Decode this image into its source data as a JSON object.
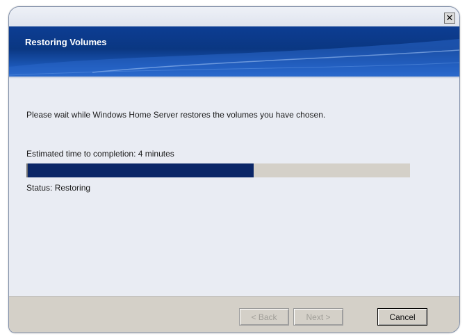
{
  "window": {
    "close_glyph": "✕"
  },
  "banner": {
    "title": "Restoring Volumes"
  },
  "content": {
    "message": "Please wait while Windows Home Server restores the volumes you have chosen.",
    "eta": "Estimated time to completion: 4 minutes",
    "progress_fraction": 0.59,
    "status": "Status: Restoring"
  },
  "buttons": {
    "back": "< Back",
    "next": "Next >",
    "cancel": "Cancel"
  },
  "colors": {
    "banner": "#0a3782",
    "progress_fill": "#0b2667",
    "footer": "#d4d0c8"
  },
  "icons": {
    "close": "close-icon"
  }
}
